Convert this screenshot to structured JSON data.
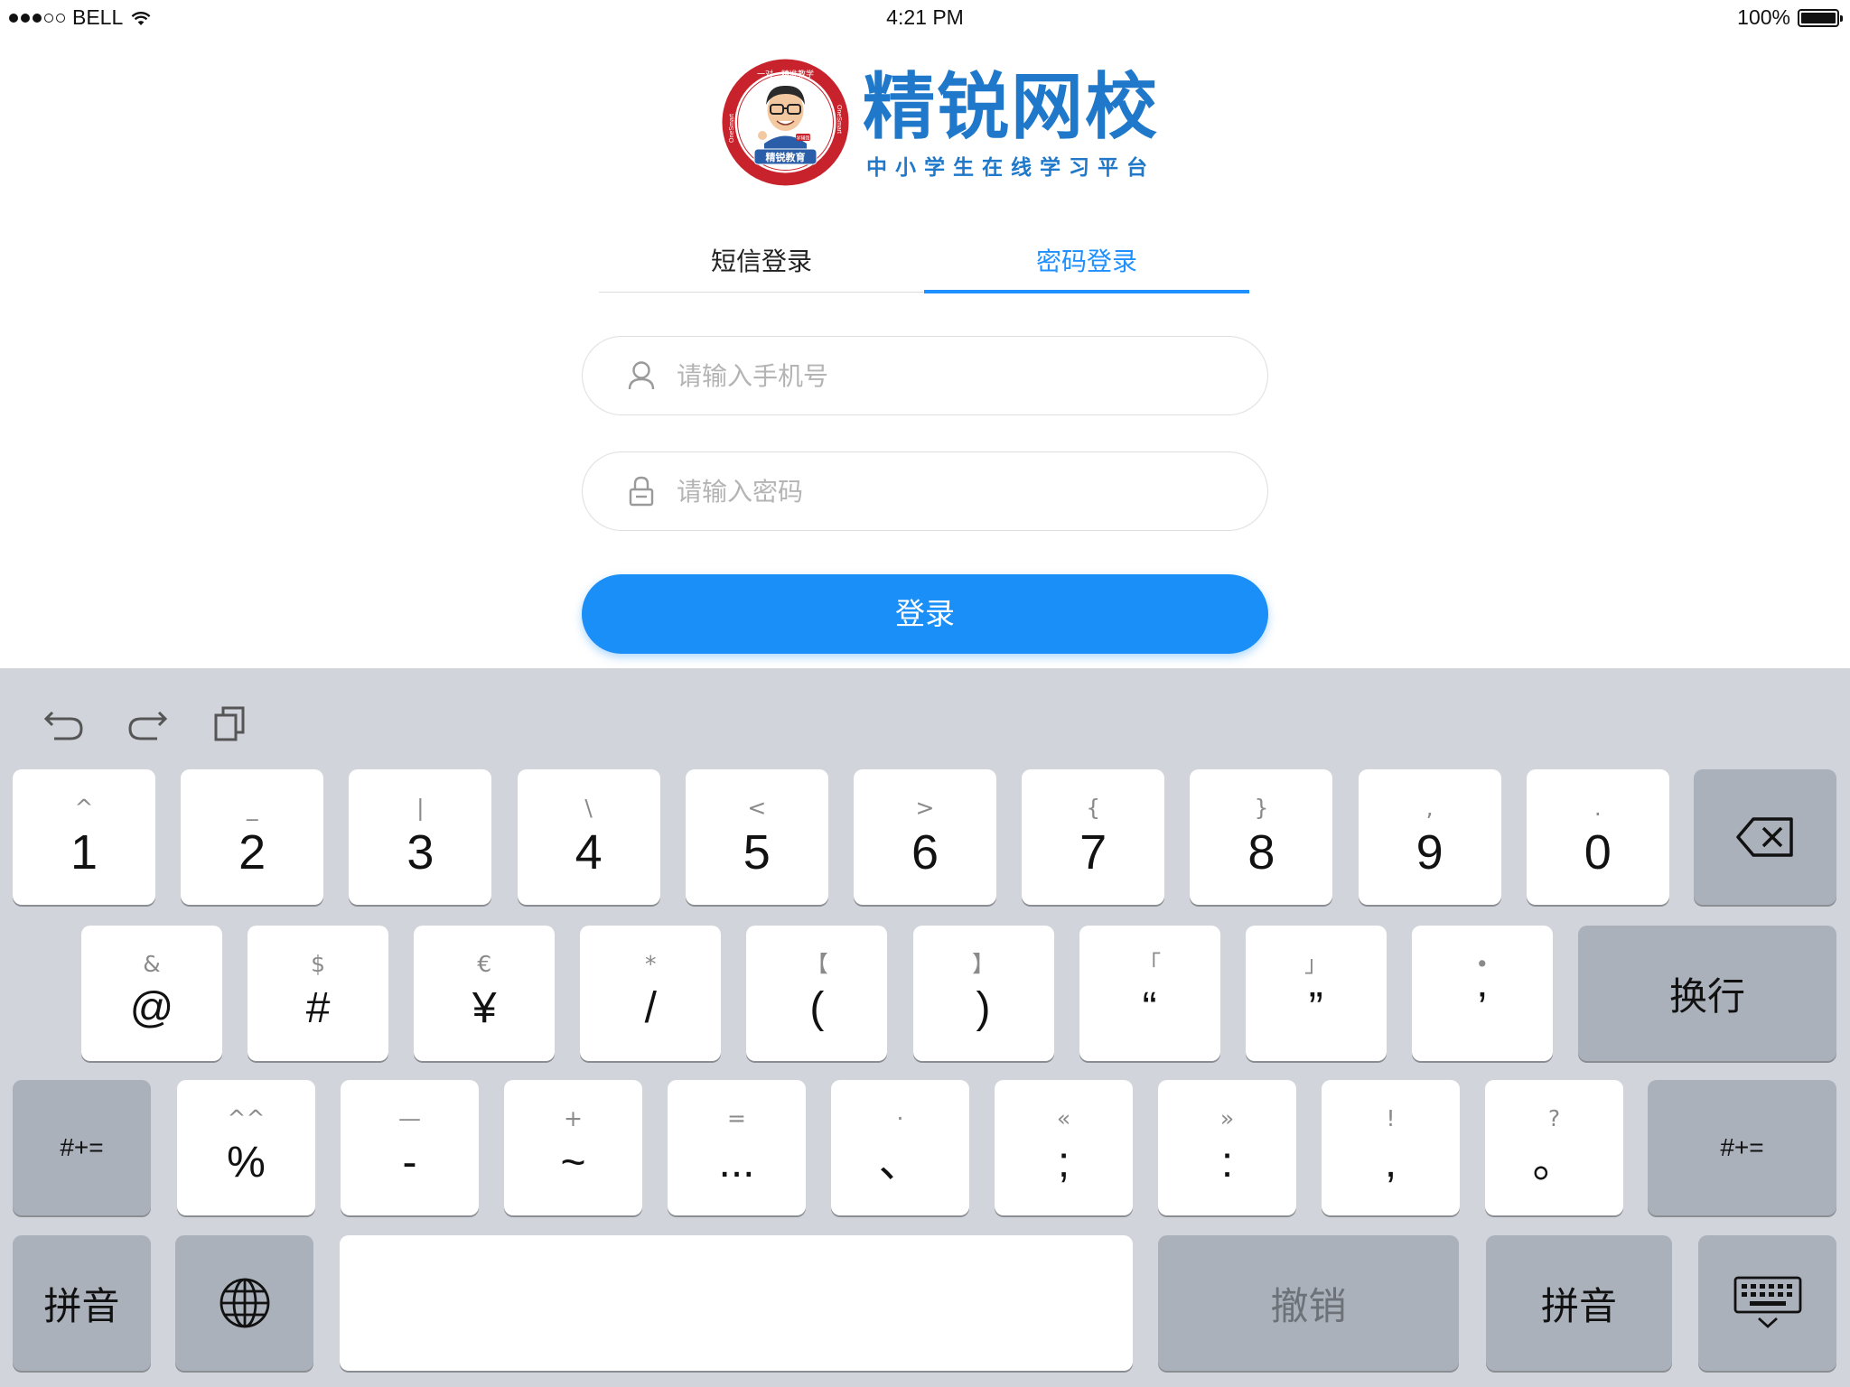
{
  "status_bar": {
    "carrier": "BELL",
    "time": "4:21 PM",
    "battery_percent": "100%",
    "signal_bars": 3
  },
  "logo": {
    "title": "精锐网校",
    "subtitle": "中小学生在线学习平台",
    "badge_text": "精锐教育",
    "badge_ring_text": "一对一精准教学",
    "badge_side_text": "OneSmart",
    "badge_tag": "学辅馆"
  },
  "tabs": [
    {
      "label": "短信登录",
      "active": false
    },
    {
      "label": "密码登录",
      "active": true
    }
  ],
  "form": {
    "phone_placeholder": "请输入手机号",
    "password_placeholder": "请输入密码",
    "login_label": "登录"
  },
  "colors": {
    "accent": "#1a8ff8",
    "logo_blue": "#1f78c9",
    "keyboard_bg": "#d1d5db"
  },
  "keyboard": {
    "toolbar": [
      "undo-icon",
      "redo-icon",
      "clipboard-icon"
    ],
    "row1": [
      {
        "sec": "^",
        "pri": "1"
      },
      {
        "sec": "_",
        "pri": "2"
      },
      {
        "sec": "|",
        "pri": "3"
      },
      {
        "sec": "\\",
        "pri": "4"
      },
      {
        "sec": "<",
        "pri": "5"
      },
      {
        "sec": ">",
        "pri": "6"
      },
      {
        "sec": "{",
        "pri": "7"
      },
      {
        "sec": "}",
        "pri": "8"
      },
      {
        "sec": ",",
        "pri": "9"
      },
      {
        "sec": ".",
        "pri": "0"
      }
    ],
    "row2": [
      {
        "sec": "&",
        "pri": "@"
      },
      {
        "sec": "$",
        "pri": "#"
      },
      {
        "sec": "€",
        "pri": "¥"
      },
      {
        "sec": "*",
        "pri": "/"
      },
      {
        "sec": "【",
        "pri": "("
      },
      {
        "sec": "】",
        "pri": ")"
      },
      {
        "sec": "「",
        "pri": "“"
      },
      {
        "sec": "」",
        "pri": "”"
      },
      {
        "sec": "•",
        "pri": "’"
      }
    ],
    "return_label": "换行",
    "row3": [
      {
        "sec": "^^",
        "pri": "%"
      },
      {
        "sec": "—",
        "pri": "-"
      },
      {
        "sec": "+",
        "pri": "~"
      },
      {
        "sec": "=",
        "pri": "..."
      },
      {
        "sec": "·",
        "pri": "、"
      },
      {
        "sec": "«",
        "pri": ";"
      },
      {
        "sec": "»",
        "pri": ":"
      },
      {
        "sec": "!",
        "pri": ","
      },
      {
        "sec": "?",
        "pri": "。"
      }
    ],
    "more_symbols_label": "#+=",
    "pinyin_label": "拼音",
    "undo_label": "撤销"
  }
}
